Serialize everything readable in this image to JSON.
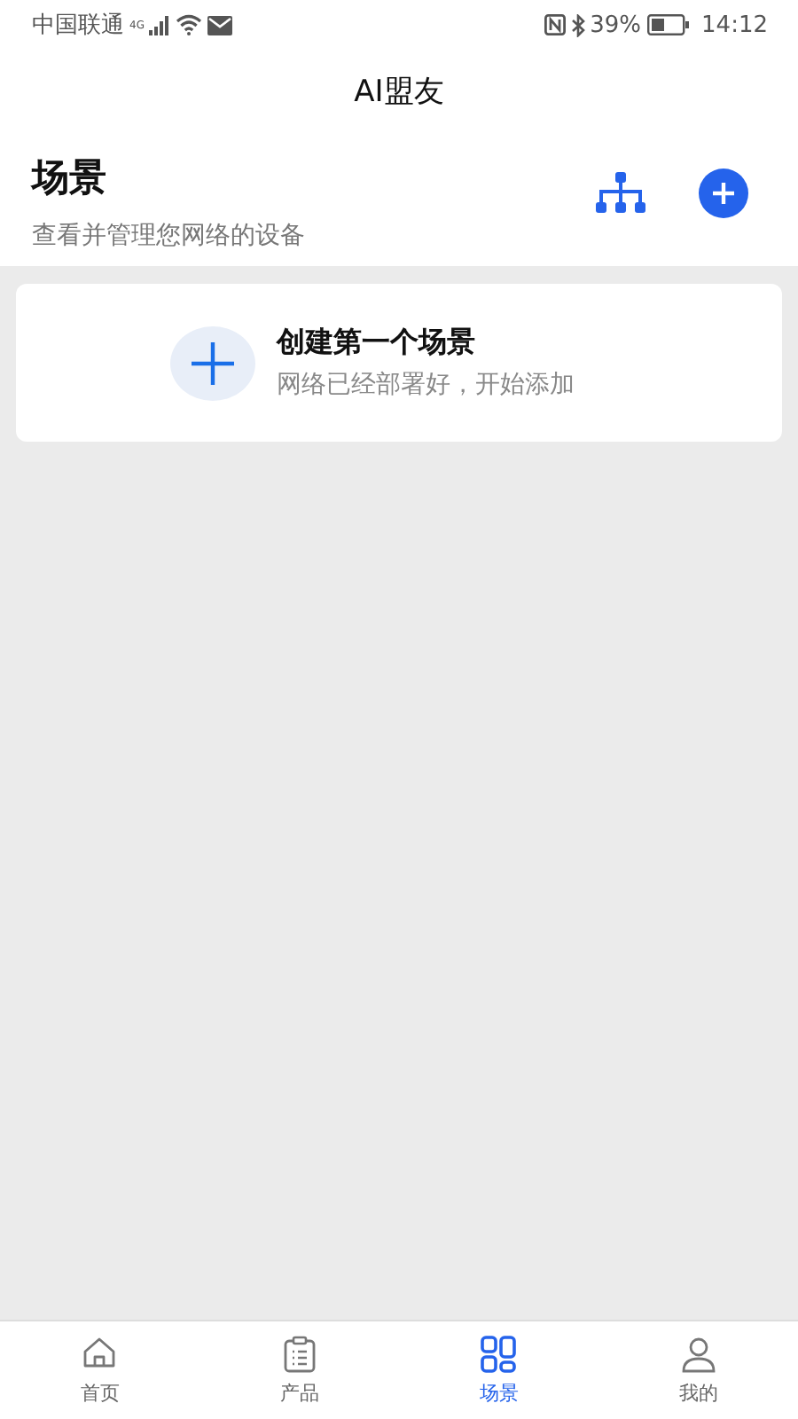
{
  "status_bar": {
    "carrier": "中国联通",
    "network": "4G",
    "battery": "39%",
    "time": "14:12"
  },
  "app_bar": {
    "title": "AI盟友"
  },
  "header": {
    "title": "场景",
    "subtitle": "查看并管理您网络的设备"
  },
  "empty_card": {
    "title": "创建第一个场景",
    "subtitle": "网络已经部署好，开始添加"
  },
  "tabs": [
    {
      "label": "首页",
      "kind": "home",
      "selected": false
    },
    {
      "label": "产品",
      "kind": "clipboard",
      "selected": false
    },
    {
      "label": "场景",
      "kind": "grid",
      "selected": true
    },
    {
      "label": "我的",
      "kind": "person",
      "selected": false
    }
  ]
}
